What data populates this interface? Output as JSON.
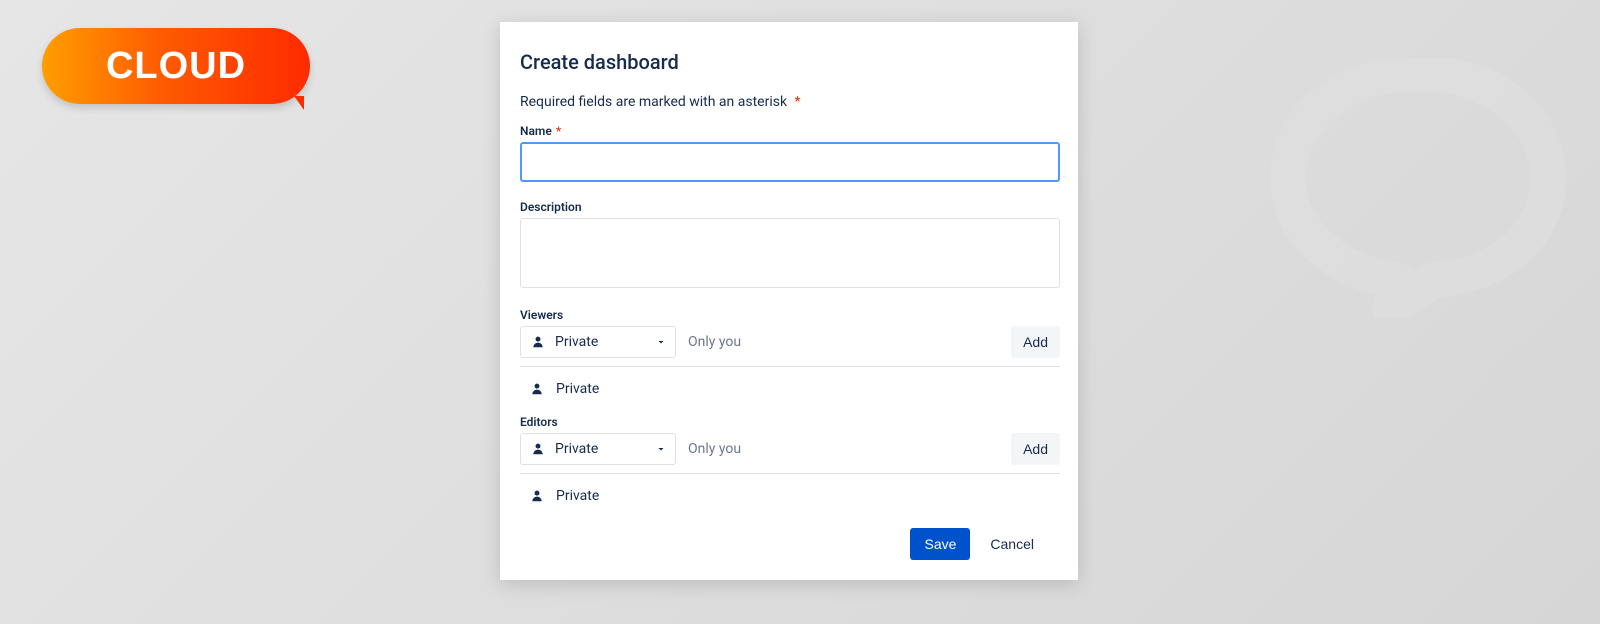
{
  "brand": {
    "pill": "CLOUD"
  },
  "dialog": {
    "title": "Create dashboard",
    "required_note": "Required fields are marked with an asterisk",
    "asterisk": "*",
    "fields": {
      "name": {
        "label": "Name",
        "value": ""
      },
      "description": {
        "label": "Description",
        "value": ""
      }
    },
    "viewers": {
      "label": "Viewers",
      "select_value": "Private",
      "hint": "Only you",
      "add_label": "Add",
      "items": [
        {
          "label": "Private"
        }
      ]
    },
    "editors": {
      "label": "Editors",
      "select_value": "Private",
      "hint": "Only you",
      "add_label": "Add",
      "items": [
        {
          "label": "Private"
        }
      ]
    },
    "footer": {
      "save": "Save",
      "cancel": "Cancel"
    }
  }
}
